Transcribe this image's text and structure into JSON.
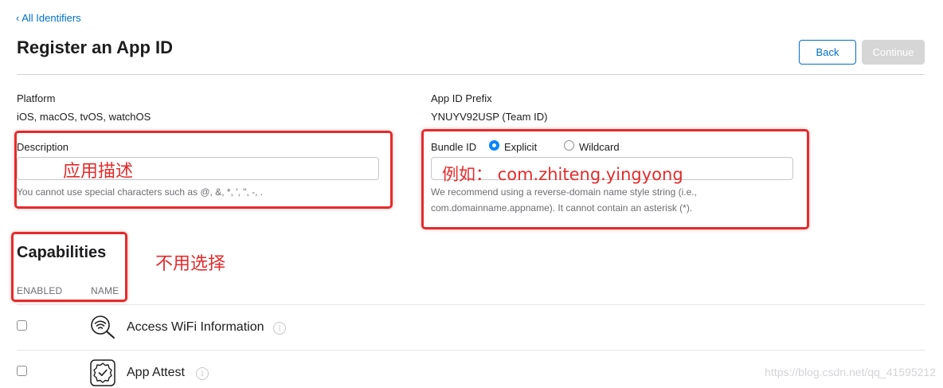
{
  "nav": {
    "back_link": "‹ All Identifiers"
  },
  "page": {
    "title": "Register an App ID"
  },
  "actions": {
    "back_label": "Back",
    "continue_label": "Continue"
  },
  "platform": {
    "label": "Platform",
    "value": "iOS, macOS, tvOS, watchOS"
  },
  "prefix": {
    "label": "App ID Prefix",
    "value": "YNUYV92USP (Team ID)"
  },
  "description": {
    "label": "Description",
    "value": "",
    "hint": "You cannot use special characters such as @, &, *, ', \", -, ."
  },
  "bundle": {
    "label": "Bundle ID",
    "options": [
      "Explicit",
      "Wildcard"
    ],
    "selected": "Explicit",
    "value": "",
    "hint_line1": "We recommend using a reverse-domain name style string (i.e.,",
    "hint_line2": "com.domainname.appname). It cannot contain an asterisk (*)."
  },
  "capabilities": {
    "title": "Capabilities",
    "col_enabled": "ENABLED",
    "col_name": "NAME",
    "items": [
      {
        "name": "Access WiFi Information",
        "icon": "wifi-search-icon",
        "checked": false
      },
      {
        "name": "App Attest",
        "icon": "verified-badge-icon",
        "checked": false
      }
    ]
  },
  "annotations": {
    "description_note": "应用描述",
    "bundle_note": "例如： com.zhiteng.yingyong",
    "capabilities_note": "不用选择"
  },
  "watermark": "https://blog.csdn.net/qq_41595212",
  "colors": {
    "accent": "#0070c9",
    "annotation": "#e52b2b",
    "disabled": "#d6d6d6"
  }
}
